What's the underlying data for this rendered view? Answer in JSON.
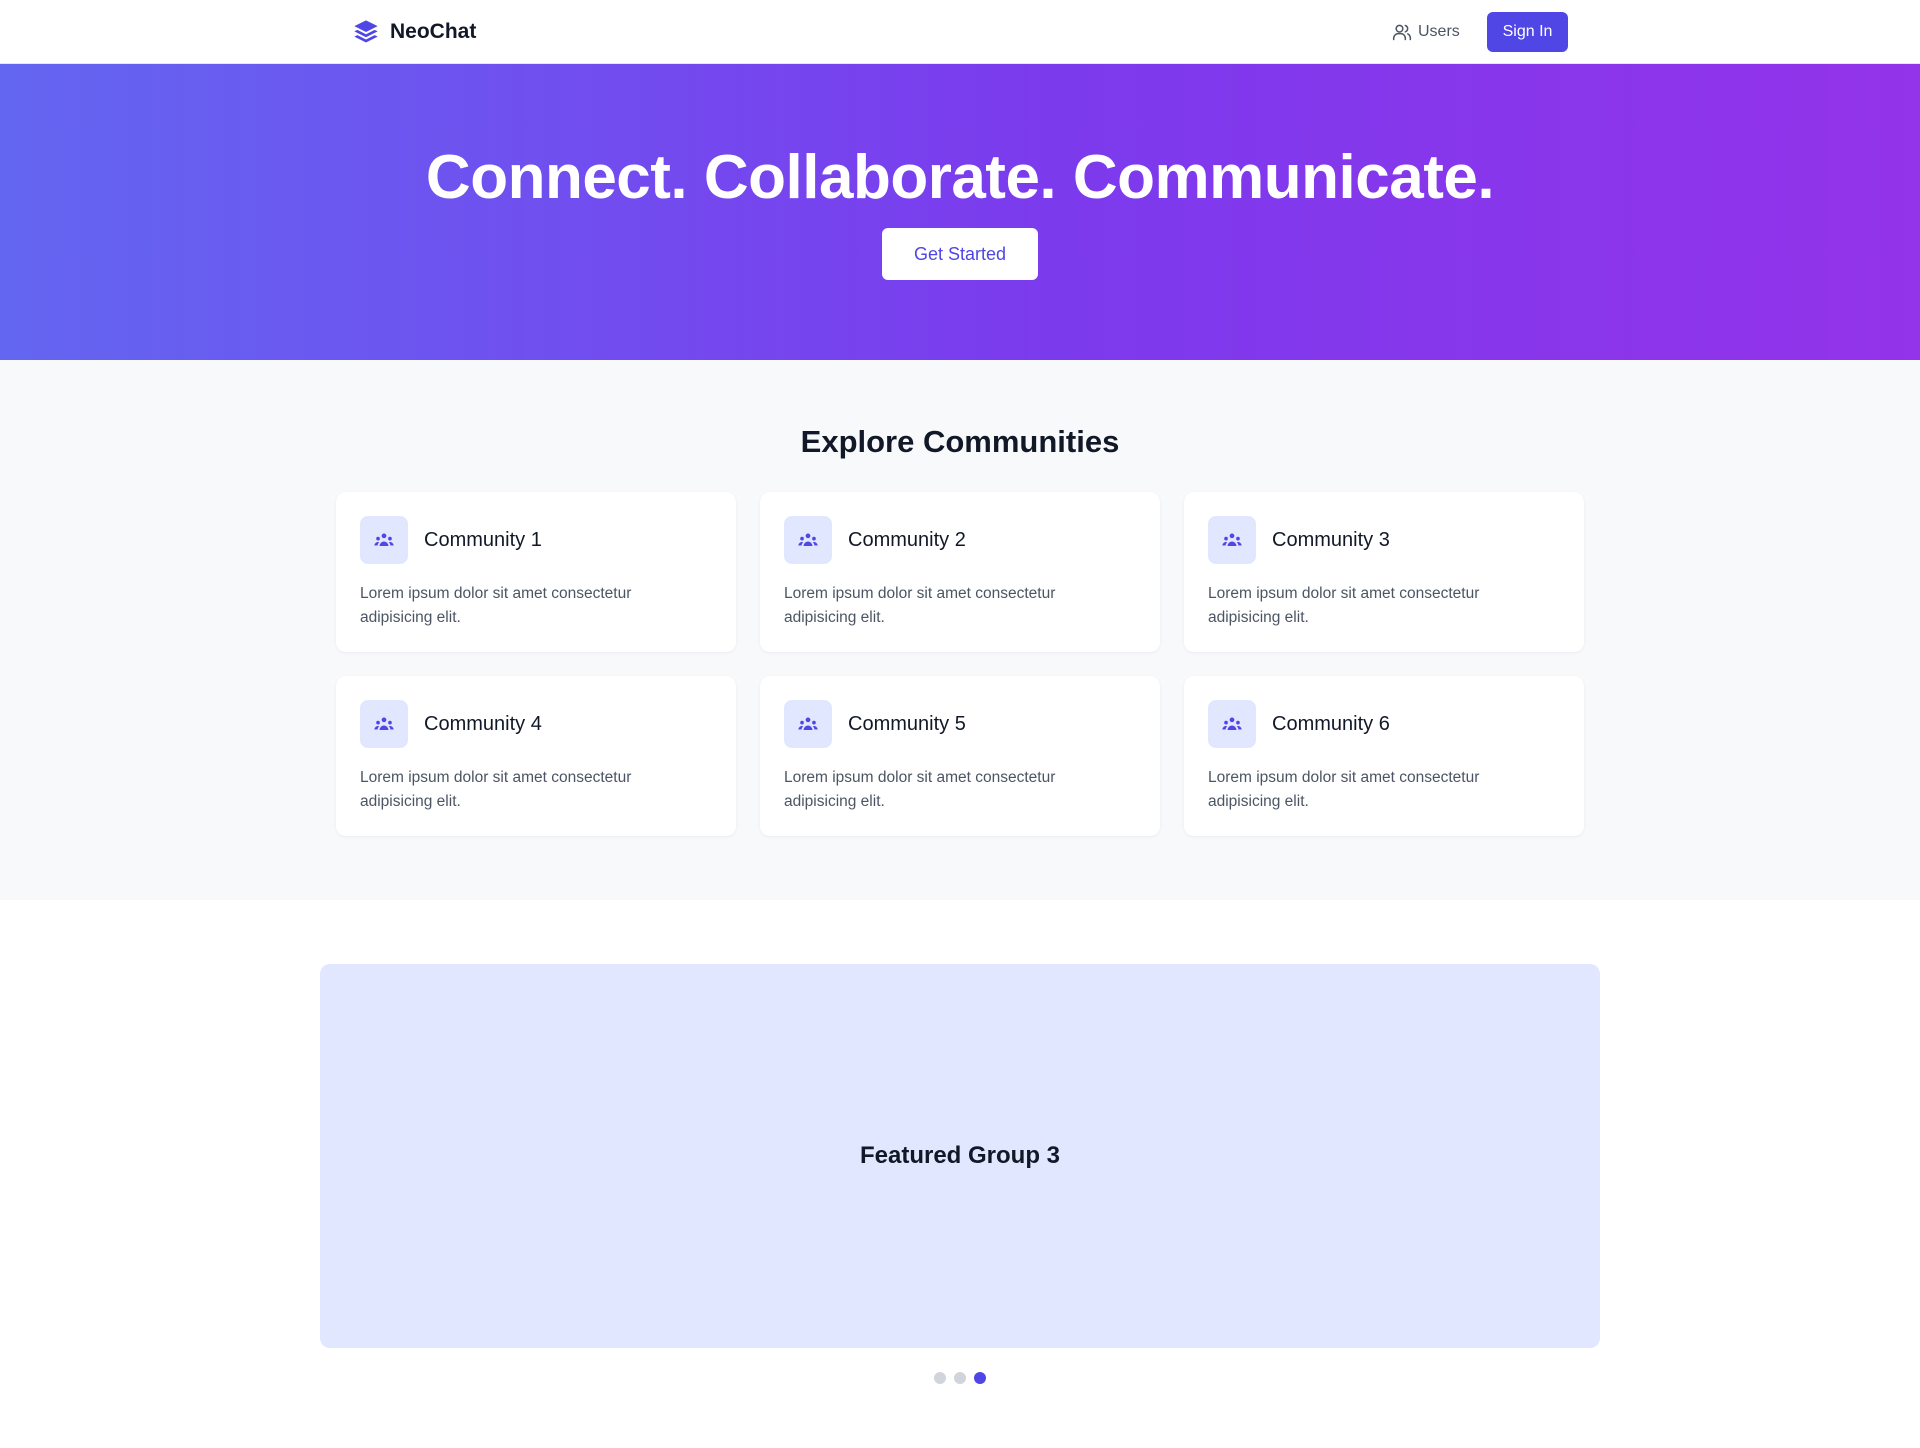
{
  "nav": {
    "brand": "NeoChat",
    "users_label": "Users",
    "signin_label": "Sign In"
  },
  "hero": {
    "title": "Connect. Collaborate. Communicate.",
    "cta_label": "Get Started"
  },
  "explore": {
    "title": "Explore Communities",
    "communities": [
      {
        "name": "Community 1",
        "description": "Lorem ipsum dolor sit amet consectetur adipisicing elit."
      },
      {
        "name": "Community 2",
        "description": "Lorem ipsum dolor sit amet consectetur adipisicing elit."
      },
      {
        "name": "Community 3",
        "description": "Lorem ipsum dolor sit amet consectetur adipisicing elit."
      },
      {
        "name": "Community 4",
        "description": "Lorem ipsum dolor sit amet consectetur adipisicing elit."
      },
      {
        "name": "Community 5",
        "description": "Lorem ipsum dolor sit amet consectetur adipisicing elit."
      },
      {
        "name": "Community 6",
        "description": "Lorem ipsum dolor sit amet consectetur adipisicing elit."
      }
    ]
  },
  "carousel": {
    "slide_title": "Featured Group 3",
    "slide_count": 3,
    "active_index": 2
  },
  "colors": {
    "accent": "#4f46e5",
    "hero_gradient_start": "#6366f1",
    "hero_gradient_end": "#9333ea",
    "icon_bg": "#e0e7ff"
  },
  "icons": {
    "brand": "layers-icon",
    "users": "users-icon",
    "community": "user-group-icon"
  }
}
